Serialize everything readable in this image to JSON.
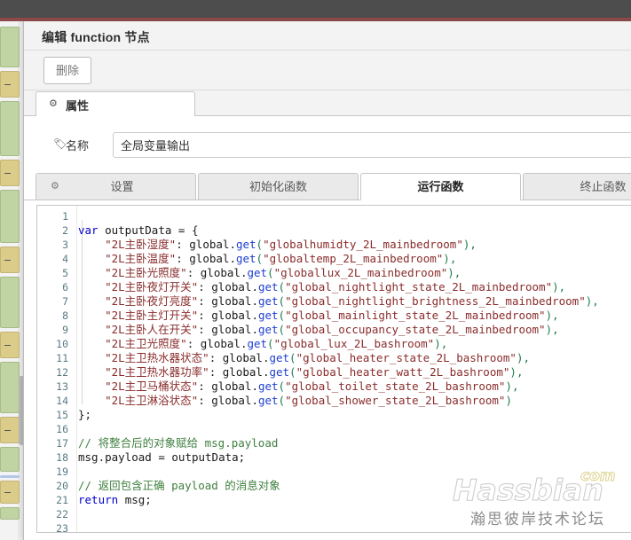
{
  "window": {
    "topbar_color": "#4d4d4d",
    "accent_line_color": "#8e4a4a"
  },
  "dialog": {
    "title": "编辑 function 节点",
    "delete_label": "删除",
    "props_tab": {
      "label": "属性",
      "icon": "gear-icon"
    },
    "name_row": {
      "icon": "tag-icon",
      "label": "名称",
      "value": "全局变量输出",
      "placeholder": "名称"
    },
    "subtabs": [
      {
        "label": "设置",
        "icon": "gear-icon",
        "active": false
      },
      {
        "label": "初始化函数",
        "icon": null,
        "active": false
      },
      {
        "label": "运行函数",
        "icon": null,
        "active": true
      },
      {
        "label": "终止函数",
        "icon": null,
        "active": false
      }
    ]
  },
  "editor": {
    "line_numbers": [
      1,
      2,
      3,
      4,
      5,
      6,
      7,
      8,
      9,
      10,
      11,
      12,
      13,
      14,
      15,
      16,
      17,
      18,
      19,
      20,
      21,
      22,
      23
    ],
    "lines": [
      {
        "n": 1,
        "tokens": []
      },
      {
        "n": 2,
        "tokens": [
          {
            "t": "var ",
            "c": "k"
          },
          {
            "t": "outputData ",
            "c": "p"
          },
          {
            "t": "= ",
            "c": "p"
          },
          {
            "t": "{",
            "c": "br"
          }
        ]
      },
      {
        "n": 3,
        "tokens": [
          {
            "t": "    ",
            "c": "p"
          },
          {
            "t": "\"2L主卧湿度\"",
            "c": "s"
          },
          {
            "t": ": ",
            "c": "p"
          },
          {
            "t": "global",
            "c": "p"
          },
          {
            "t": ".",
            "c": "p"
          },
          {
            "t": "get",
            "c": "fn"
          },
          {
            "t": "(",
            "c": "q"
          },
          {
            "t": "\"globalhumidty_2L_mainbedroom\"",
            "c": "s"
          },
          {
            "t": ")",
            "c": "q"
          },
          {
            "t": ",",
            "c": "q"
          }
        ]
      },
      {
        "n": 4,
        "tokens": [
          {
            "t": "    ",
            "c": "p"
          },
          {
            "t": "\"2L主卧温度\"",
            "c": "s"
          },
          {
            "t": ": ",
            "c": "p"
          },
          {
            "t": "global",
            "c": "p"
          },
          {
            "t": ".",
            "c": "p"
          },
          {
            "t": "get",
            "c": "fn"
          },
          {
            "t": "(",
            "c": "q"
          },
          {
            "t": "\"globaltemp_2L_mainbedroom\"",
            "c": "s"
          },
          {
            "t": ")",
            "c": "q"
          },
          {
            "t": ",",
            "c": "q"
          }
        ]
      },
      {
        "n": 5,
        "tokens": [
          {
            "t": "    ",
            "c": "p"
          },
          {
            "t": "\"2L主卧光照度\"",
            "c": "s"
          },
          {
            "t": ": ",
            "c": "p"
          },
          {
            "t": "global",
            "c": "p"
          },
          {
            "t": ".",
            "c": "p"
          },
          {
            "t": "get",
            "c": "fn"
          },
          {
            "t": "(",
            "c": "q"
          },
          {
            "t": "\"globallux_2L_mainbedroom\"",
            "c": "s"
          },
          {
            "t": ")",
            "c": "q"
          },
          {
            "t": ",",
            "c": "q"
          }
        ]
      },
      {
        "n": 6,
        "tokens": [
          {
            "t": "    ",
            "c": "p"
          },
          {
            "t": "\"2L主卧夜灯开关\"",
            "c": "s"
          },
          {
            "t": ": ",
            "c": "p"
          },
          {
            "t": "global",
            "c": "p"
          },
          {
            "t": ".",
            "c": "p"
          },
          {
            "t": "get",
            "c": "fn"
          },
          {
            "t": "(",
            "c": "q"
          },
          {
            "t": "\"global_nightlight_state_2L_mainbedroom\"",
            "c": "s"
          },
          {
            "t": ")",
            "c": "q"
          },
          {
            "t": ",",
            "c": "q"
          }
        ]
      },
      {
        "n": 7,
        "tokens": [
          {
            "t": "    ",
            "c": "p"
          },
          {
            "t": "\"2L主卧夜灯亮度\"",
            "c": "s"
          },
          {
            "t": ": ",
            "c": "p"
          },
          {
            "t": "global",
            "c": "p"
          },
          {
            "t": ".",
            "c": "p"
          },
          {
            "t": "get",
            "c": "fn"
          },
          {
            "t": "(",
            "c": "q"
          },
          {
            "t": "\"global_nightlight_brightness_2L_mainbedroom\"",
            "c": "s"
          },
          {
            "t": ")",
            "c": "q"
          },
          {
            "t": ",",
            "c": "q"
          }
        ]
      },
      {
        "n": 8,
        "tokens": [
          {
            "t": "    ",
            "c": "p"
          },
          {
            "t": "\"2L主卧主灯开关\"",
            "c": "s"
          },
          {
            "t": ": ",
            "c": "p"
          },
          {
            "t": "global",
            "c": "p"
          },
          {
            "t": ".",
            "c": "p"
          },
          {
            "t": "get",
            "c": "fn"
          },
          {
            "t": "(",
            "c": "q"
          },
          {
            "t": "\"global_mainlight_state_2L_mainbedroom\"",
            "c": "s"
          },
          {
            "t": ")",
            "c": "q"
          },
          {
            "t": ",",
            "c": "q"
          }
        ]
      },
      {
        "n": 9,
        "tokens": [
          {
            "t": "    ",
            "c": "p"
          },
          {
            "t": "\"2L主卧人在开关\"",
            "c": "s"
          },
          {
            "t": ": ",
            "c": "p"
          },
          {
            "t": "global",
            "c": "p"
          },
          {
            "t": ".",
            "c": "p"
          },
          {
            "t": "get",
            "c": "fn"
          },
          {
            "t": "(",
            "c": "q"
          },
          {
            "t": "\"global_occupancy_state_2L_mainbedroom\"",
            "c": "s"
          },
          {
            "t": ")",
            "c": "q"
          },
          {
            "t": ",",
            "c": "q"
          }
        ]
      },
      {
        "n": 10,
        "tokens": [
          {
            "t": "    ",
            "c": "p"
          },
          {
            "t": "\"2L主卫光照度\"",
            "c": "s"
          },
          {
            "t": ": ",
            "c": "p"
          },
          {
            "t": "global",
            "c": "p"
          },
          {
            "t": ".",
            "c": "p"
          },
          {
            "t": "get",
            "c": "fn"
          },
          {
            "t": "(",
            "c": "q"
          },
          {
            "t": "\"global_lux_2L_bashroom\"",
            "c": "s"
          },
          {
            "t": ")",
            "c": "q"
          },
          {
            "t": ",",
            "c": "q"
          }
        ]
      },
      {
        "n": 11,
        "tokens": [
          {
            "t": "    ",
            "c": "p"
          },
          {
            "t": "\"2L主卫热水器状态\"",
            "c": "s"
          },
          {
            "t": ": ",
            "c": "p"
          },
          {
            "t": "global",
            "c": "p"
          },
          {
            "t": ".",
            "c": "p"
          },
          {
            "t": "get",
            "c": "fn"
          },
          {
            "t": "(",
            "c": "q"
          },
          {
            "t": "\"global_heater_state_2L_bashroom\"",
            "c": "s"
          },
          {
            "t": ")",
            "c": "q"
          },
          {
            "t": ",",
            "c": "q"
          }
        ]
      },
      {
        "n": 12,
        "tokens": [
          {
            "t": "    ",
            "c": "p"
          },
          {
            "t": "\"2L主卫热水器功率\"",
            "c": "s"
          },
          {
            "t": ": ",
            "c": "p"
          },
          {
            "t": "global",
            "c": "p"
          },
          {
            "t": ".",
            "c": "p"
          },
          {
            "t": "get",
            "c": "fn"
          },
          {
            "t": "(",
            "c": "q"
          },
          {
            "t": "\"global_heater_watt_2L_bashroom\"",
            "c": "s"
          },
          {
            "t": ")",
            "c": "q"
          },
          {
            "t": ",",
            "c": "q"
          }
        ]
      },
      {
        "n": 13,
        "tokens": [
          {
            "t": "    ",
            "c": "p"
          },
          {
            "t": "\"2L主卫马桶状态\"",
            "c": "s"
          },
          {
            "t": ": ",
            "c": "p"
          },
          {
            "t": "global",
            "c": "p"
          },
          {
            "t": ".",
            "c": "p"
          },
          {
            "t": "get",
            "c": "fn"
          },
          {
            "t": "(",
            "c": "q"
          },
          {
            "t": "\"global_toilet_state_2L_bashroom\"",
            "c": "s"
          },
          {
            "t": ")",
            "c": "q"
          },
          {
            "t": ",",
            "c": "q"
          }
        ]
      },
      {
        "n": 14,
        "tokens": [
          {
            "t": "    ",
            "c": "p"
          },
          {
            "t": "\"2L主卫淋浴状态\"",
            "c": "s"
          },
          {
            "t": ": ",
            "c": "p"
          },
          {
            "t": "global",
            "c": "p"
          },
          {
            "t": ".",
            "c": "p"
          },
          {
            "t": "get",
            "c": "fn"
          },
          {
            "t": "(",
            "c": "q"
          },
          {
            "t": "\"global_shower_state_2L_bashroom\"",
            "c": "s"
          },
          {
            "t": ")",
            "c": "q"
          }
        ]
      },
      {
        "n": 15,
        "tokens": [
          {
            "t": "};",
            "c": "br"
          }
        ]
      },
      {
        "n": 16,
        "tokens": []
      },
      {
        "n": 17,
        "tokens": [
          {
            "t": "// 将整合后的对象赋给 msg.payload",
            "c": "cm"
          }
        ]
      },
      {
        "n": 18,
        "tokens": [
          {
            "t": "msg",
            "c": "p"
          },
          {
            "t": ".",
            "c": "p"
          },
          {
            "t": "payload ",
            "c": "p"
          },
          {
            "t": "= ",
            "c": "p"
          },
          {
            "t": "outputData;",
            "c": "p"
          }
        ]
      },
      {
        "n": 19,
        "tokens": []
      },
      {
        "n": 20,
        "tokens": [
          {
            "t": "// 返回包含正确 payload 的消息对象",
            "c": "cm"
          }
        ]
      },
      {
        "n": 21,
        "tokens": [
          {
            "t": "return ",
            "c": "k"
          },
          {
            "t": "msg;",
            "c": "p"
          }
        ]
      },
      {
        "n": 22,
        "tokens": []
      },
      {
        "n": 23,
        "tokens": []
      }
    ]
  },
  "watermark": {
    "main": "Hassbian",
    "suffix": "com",
    "subtitle": "瀚思彼岸技术论坛"
  }
}
